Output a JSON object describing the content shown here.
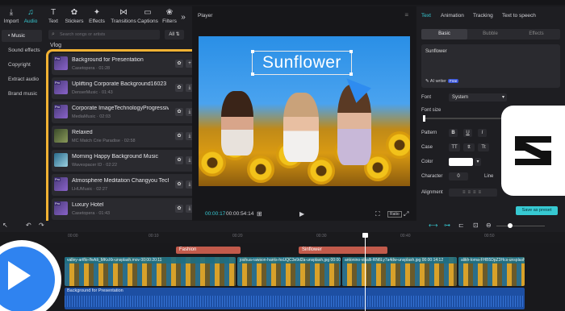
{
  "toolbar": {
    "tools": [
      {
        "label": "Import",
        "icon": "import-icon",
        "glyph": "⤓"
      },
      {
        "label": "Audio",
        "icon": "audio-icon",
        "glyph": "♫"
      },
      {
        "label": "Text",
        "icon": "text-icon",
        "glyph": "T"
      },
      {
        "label": "Stickers",
        "icon": "sticker-icon",
        "glyph": "✿"
      },
      {
        "label": "Effects",
        "icon": "effects-icon",
        "glyph": "✦"
      },
      {
        "label": "Transitions",
        "icon": "transitions-icon",
        "glyph": "⋈"
      },
      {
        "label": "Captions",
        "icon": "captions-icon",
        "glyph": "▭"
      },
      {
        "label": "Filters",
        "icon": "filters-icon",
        "glyph": "❀"
      }
    ],
    "more_glyph": "»"
  },
  "categories": [
    {
      "label": "• Music"
    },
    {
      "label": "Sound effects"
    },
    {
      "label": "Copyright"
    },
    {
      "label": "Extract audio"
    },
    {
      "label": "Brand music"
    }
  ],
  "library": {
    "search_placeholder": "Search songs or artists",
    "all_label": "All ⇅",
    "section": "Vlog",
    "tracks": [
      {
        "name": "Background for Presentation",
        "sub": "Casetopera · 01:28",
        "pro": true
      },
      {
        "name": "Uplifting Corporate Background16023",
        "sub": "DenserMusic · 01:43",
        "pro": true
      },
      {
        "name": "Corporate ImageTechnologyProgressive...",
        "sub": "MediaMusic · 02:03",
        "pro": true
      },
      {
        "name": "Relaxed",
        "sub": "MC Match Crie Paradise · 02:58",
        "pro": false
      },
      {
        "name": "Morning Happy Background Music",
        "sub": "Wavespacer ID · 02:22",
        "pro": false
      },
      {
        "name": "Atmosphere Meditation Changyou Tech...",
        "sub": "LHUMusic · 02:27",
        "pro": true
      },
      {
        "name": "Luxury Hotel",
        "sub": "Casetopera · 01:43",
        "pro": true
      }
    ],
    "fav_glyph": "✿",
    "dl_glyph": "⤓"
  },
  "player": {
    "title": "Player",
    "caption": "Sunflower",
    "time_current": "00:00:17",
    "time_total": "00:00:54:14",
    "ratio": "Ratio"
  },
  "inspector": {
    "tabs": [
      "Text",
      "Animation",
      "Tracking",
      "Text to speech"
    ],
    "subtabs": [
      "Basic",
      "Bubble",
      "Effects"
    ],
    "text_value": "Sunflower",
    "ai_writer": "AI writer",
    "free": "Free",
    "font_label": "Font",
    "font_value": "System",
    "font_size_label": "Font size",
    "pattern_label": "Pattern",
    "case_label": "Case",
    "color_label": "Color",
    "character_label": "Character",
    "character_value": "0",
    "line_label": "Line",
    "alignment_label": "Alignment",
    "save_preset": "Save as preset",
    "pattern_buttons": [
      "B",
      "U",
      "I"
    ],
    "case_buttons": [
      "TT",
      "tt",
      "Tt"
    ]
  },
  "timeline": {
    "ruler_ticks": [
      "00:00",
      "00:10",
      "00:20",
      "00:30",
      "00:40",
      "00:50"
    ],
    "label_clips": [
      "Fashion",
      "Sinflower"
    ],
    "video_clips": [
      "valley-artflo-Ifwfdi_MKsXk-unsplash.mov  00:00:20:11",
      "joshua-rawson-harris-hsUQC3e9d2a-unsplash.jpg  00:00:14:00",
      "antonino-visalli-RN6Ly7a4dw-unsplash.jpg  00:00:14:12",
      "alikh-loma-FHB5DpZ3Hcs-unsplash"
    ],
    "audio_clip": "Background for Presentation"
  },
  "colors": {
    "accent": "#37c9d2",
    "highlight": "#f2b233",
    "audio": "#1d4fa3",
    "label_clip": "#c25a4b"
  }
}
